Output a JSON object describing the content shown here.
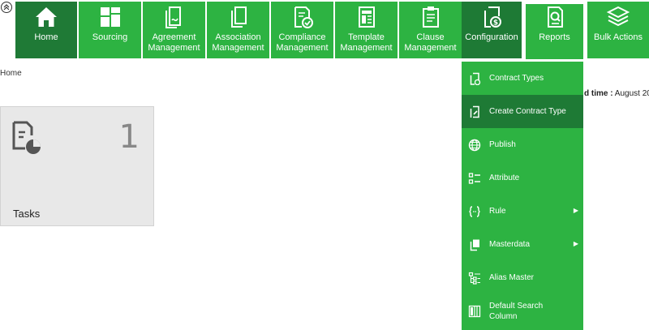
{
  "nav": {
    "items": [
      {
        "label": "Home"
      },
      {
        "label": "Sourcing"
      },
      {
        "label": "Agreement Management"
      },
      {
        "label": "Association Management"
      },
      {
        "label": "Compliance Management"
      },
      {
        "label": "Template Management"
      },
      {
        "label": "Clause Management"
      },
      {
        "label": "Configuration"
      },
      {
        "label": "Reports"
      },
      {
        "label": "Bulk Actions"
      }
    ]
  },
  "breadcrumb": {
    "home": "Home"
  },
  "last_login": {
    "label": "d time :",
    "value": "August 20,"
  },
  "task_card": {
    "count": "1",
    "label": "Tasks"
  },
  "config_menu": {
    "items": [
      {
        "label": "Contract Types"
      },
      {
        "label": "Create Contract Type"
      },
      {
        "label": "Publish"
      },
      {
        "label": "Attribute"
      },
      {
        "label": "Rule"
      },
      {
        "label": "Masterdata"
      },
      {
        "label": "Alias Master"
      },
      {
        "label": "Default Search Column"
      }
    ],
    "submenu_arrow": "▶"
  },
  "colors": {
    "nav_green": "#2db342",
    "nav_dark_green": "#1e7a35",
    "card_bg": "#e8e8e8"
  }
}
